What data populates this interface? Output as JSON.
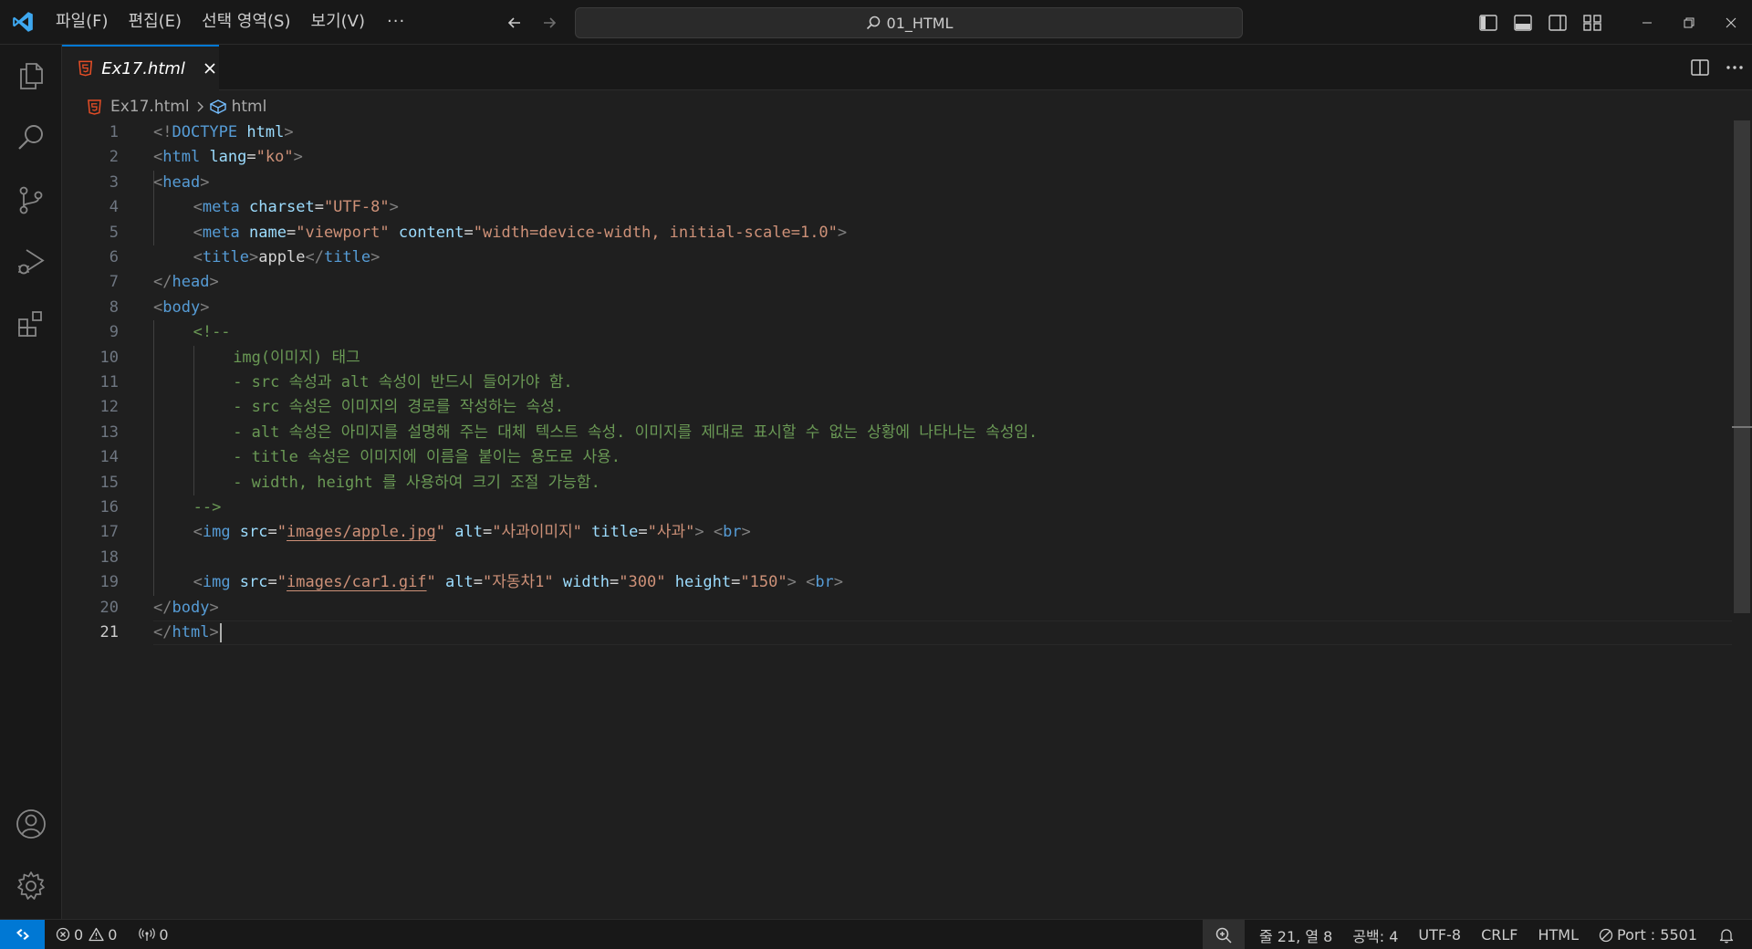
{
  "menu": {
    "file": "파일(F)",
    "edit": "편집(E)",
    "selection": "선택 영역(S)",
    "view": "보기(V)",
    "more": "···"
  },
  "search": {
    "text": "01_HTML"
  },
  "tab": {
    "name": "Ex17.html"
  },
  "breadcrumb": {
    "file": "Ex17.html",
    "symbol": "html"
  },
  "editor": {
    "active_line": 21,
    "lines": [
      "1",
      "2",
      "3",
      "4",
      "5",
      "6",
      "7",
      "8",
      "9",
      "10",
      "11",
      "12",
      "13",
      "14",
      "15",
      "16",
      "17",
      "18",
      "19",
      "20",
      "21"
    ],
    "code": {
      "l1": {
        "a": "<!",
        "b": "DOCTYPE",
        "c": " html",
        "d": ">"
      },
      "l2": {
        "a": "<",
        "b": "html",
        "c": " lang",
        "d": "=",
        "e": "\"ko\"",
        "f": ">"
      },
      "l3": {
        "a": "<",
        "b": "head",
        "c": ">"
      },
      "l4": {
        "a": "<",
        "b": "meta",
        "c": " charset",
        "d": "=",
        "e": "\"UTF-8\"",
        "f": ">"
      },
      "l5": {
        "a": "<",
        "b": "meta",
        "c": " name",
        "d": "=",
        "e": "\"viewport\"",
        "f": " content",
        "g": "=",
        "h": "\"width=device-width, initial-scale=1.0\"",
        "i": ">"
      },
      "l6": {
        "a": "<",
        "b": "title",
        "c": ">",
        "d": "apple",
        "e": "</",
        "f": "title",
        "g": ">"
      },
      "l7": {
        "a": "</",
        "b": "head",
        "c": ">"
      },
      "l8": {
        "a": "<",
        "b": "body",
        "c": ">"
      },
      "l9": "<!--",
      "l10": "img(이미지) 태그",
      "l11": "- src 속성과 alt 속성이 반드시 들어가야 함.",
      "l12": "- src 속성은 이미지의 경로를 작성하는 속성.",
      "l13": "- alt 속성은 아미지를 설명해 주는 대체 텍스트 속성. 이미지를 제대로 표시할 수 없는 상황에 나타나는 속성임.",
      "l14": "- title 속성은 이미지에 이름을 붙이는 용도로 사용.",
      "l15": "- width, height 를 사용하여 크기 조절 가능함.",
      "l16": "-->",
      "l17": {
        "a": "<",
        "b": "img",
        "c": " src",
        "d": "=",
        "e1": "\"",
        "e2": "images/apple.jpg",
        "e3": "\"",
        "f": " alt",
        "g": "=",
        "h": "\"사과이미지\"",
        "i": " title",
        "j": "=",
        "k": "\"사과\"",
        "l": ">",
        "m": " <",
        "n": "br",
        "o": ">"
      },
      "l19": {
        "a": "<",
        "b": "img",
        "c": " src",
        "d": "=",
        "e1": "\"",
        "e2": "images/car1.gif",
        "e3": "\"",
        "f": " alt",
        "g": "=",
        "h": "\"자동차1\"",
        "i": " width",
        "j": "=",
        "k": "\"300\"",
        "l": " height",
        "m": "=",
        "n": "\"150\"",
        "o": ">",
        "p": " <",
        "q": "br",
        "r": ">"
      },
      "l20": {
        "a": "</",
        "b": "body",
        "c": ">"
      },
      "l21": {
        "a": "</",
        "b": "html",
        "c": ">"
      }
    }
  },
  "status": {
    "errors": "0",
    "warnings": "0",
    "ports": "0",
    "position": "줄 21, 열 8",
    "spaces": "공백: 4",
    "encoding": "UTF-8",
    "eol": "CRLF",
    "language": "HTML",
    "port": "Port : 5501"
  },
  "colors": {
    "accent": "#0078d4",
    "html_icon": "#e44d26",
    "tag": "#569cd6",
    "attribute": "#9cdcfe",
    "string": "#ce9178",
    "comment": "#6a9955"
  },
  "icons": {
    "activity": [
      "explorer-icon",
      "search-icon",
      "source-control-icon",
      "run-debug-icon",
      "extensions-icon",
      "account-icon",
      "settings-gear-icon"
    ]
  }
}
